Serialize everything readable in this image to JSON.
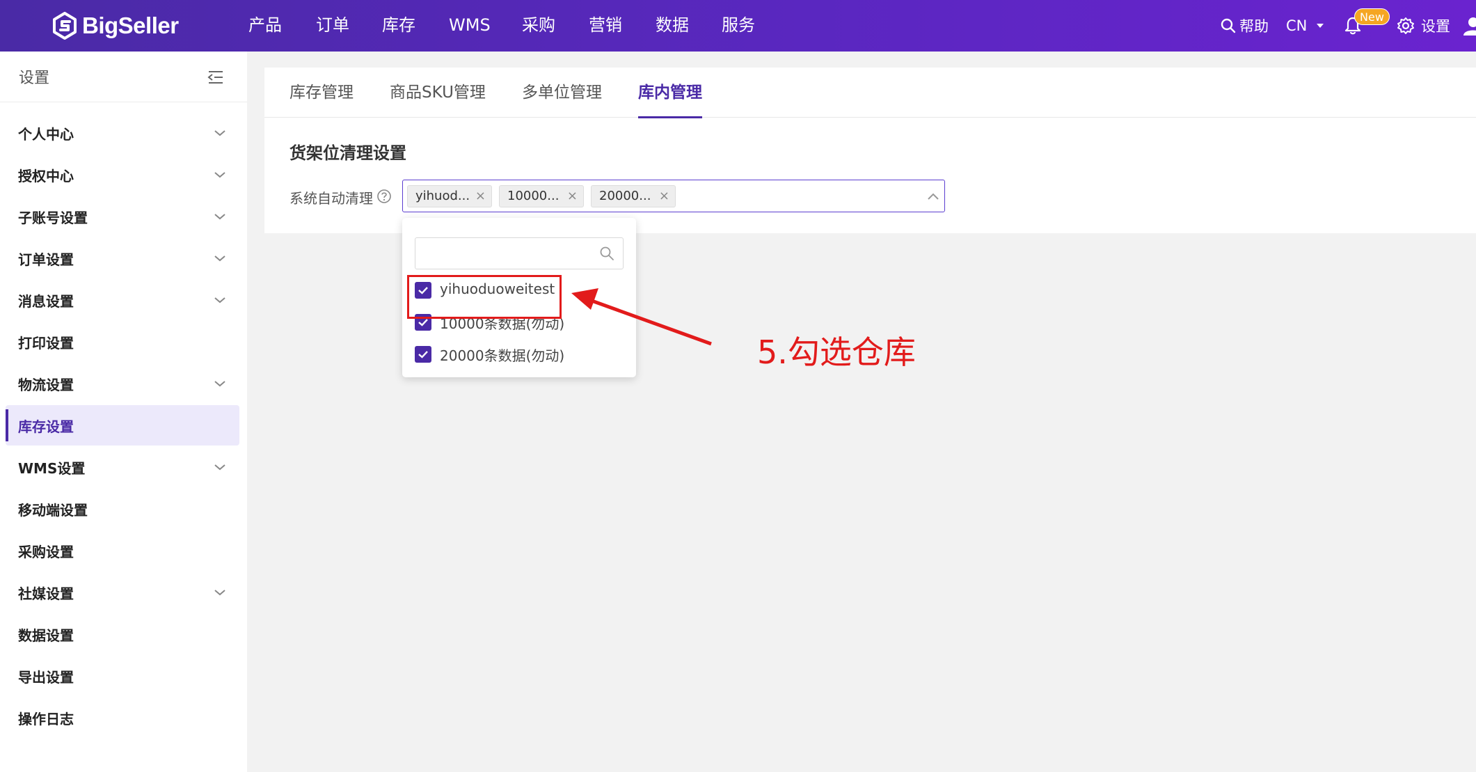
{
  "brand": {
    "name": "BigSeller",
    "accent": "#4a2aa6",
    "nav_gradient": [
      "#4a2aa6",
      "#6a23cf"
    ]
  },
  "nav": {
    "items": [
      "产品",
      "订单",
      "库存",
      "WMS",
      "采购",
      "营销",
      "数据",
      "服务"
    ],
    "help": "帮助",
    "language": "CN",
    "new_badge": "New",
    "settings": "设置"
  },
  "sidebar": {
    "title": "设置",
    "items": [
      {
        "label": "个人中心",
        "expandable": true
      },
      {
        "label": "授权中心",
        "expandable": true
      },
      {
        "label": "子账号设置",
        "expandable": true
      },
      {
        "label": "订单设置",
        "expandable": true
      },
      {
        "label": "消息设置",
        "expandable": true
      },
      {
        "label": "打印设置",
        "expandable": false
      },
      {
        "label": "物流设置",
        "expandable": true
      },
      {
        "label": "库存设置",
        "expandable": false,
        "active": true
      },
      {
        "label": "WMS设置",
        "expandable": true
      },
      {
        "label": "移动端设置",
        "expandable": false
      },
      {
        "label": "采购设置",
        "expandable": false
      },
      {
        "label": "社媒设置",
        "expandable": true
      },
      {
        "label": "数据设置",
        "expandable": false
      },
      {
        "label": "导出设置",
        "expandable": false
      },
      {
        "label": "操作日志",
        "expandable": false
      }
    ]
  },
  "tabs": {
    "items": [
      "库存管理",
      "商品SKU管理",
      "多单位管理",
      "库内管理"
    ],
    "active": "库内管理"
  },
  "section": {
    "title": "货架位清理设置",
    "field_label": "系统自动清理",
    "selected_tags": [
      "yihuod...",
      "10000...",
      "20000..."
    ]
  },
  "dropdown": {
    "search_placeholder": "",
    "options": [
      {
        "label": "yihuoduoweitest",
        "checked": true
      },
      {
        "label": "10000条数据(勿动)",
        "checked": true
      },
      {
        "label": "20000条数据(勿动)",
        "checked": true
      }
    ]
  },
  "annotation": {
    "text": "5.勾选仓库",
    "color": "#e21b1b"
  }
}
